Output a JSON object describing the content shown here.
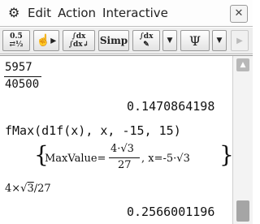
{
  "menubar": {
    "items": [
      "Edit",
      "Action",
      "Interactive"
    ],
    "close_label": "✕"
  },
  "toolbar": {
    "buttons": [
      {
        "name": "decimal-fraction-toggle",
        "label": "0.5 ⇄ 1/2"
      },
      {
        "name": "hand-play",
        "label": "☝▸"
      },
      {
        "name": "integral-transform",
        "label": "∫dx"
      },
      {
        "name": "simp",
        "label": "Simp"
      },
      {
        "name": "integral-edit",
        "label": "∫dx"
      },
      {
        "name": "dropdown-1",
        "label": "▼"
      },
      {
        "name": "graph",
        "label": "Ψ"
      },
      {
        "name": "dropdown-2",
        "label": "▼"
      },
      {
        "name": "next",
        "label": "▶"
      }
    ]
  },
  "work": {
    "entry1": {
      "numerator": "5957",
      "denominator": "40500",
      "result": "0.1470864198"
    },
    "entry2": {
      "command": "fMax(d1f(x), x, -15, 15)",
      "result_prefix": "MaxValue=",
      "max_numerator": "4·√3",
      "max_denominator": "27",
      "result_suffix": ", x=-5·√3"
    },
    "entry3": {
      "input_a": "4×",
      "input_sqrt": "3",
      "input_b": "/27",
      "result": "0.2566001196"
    }
  }
}
